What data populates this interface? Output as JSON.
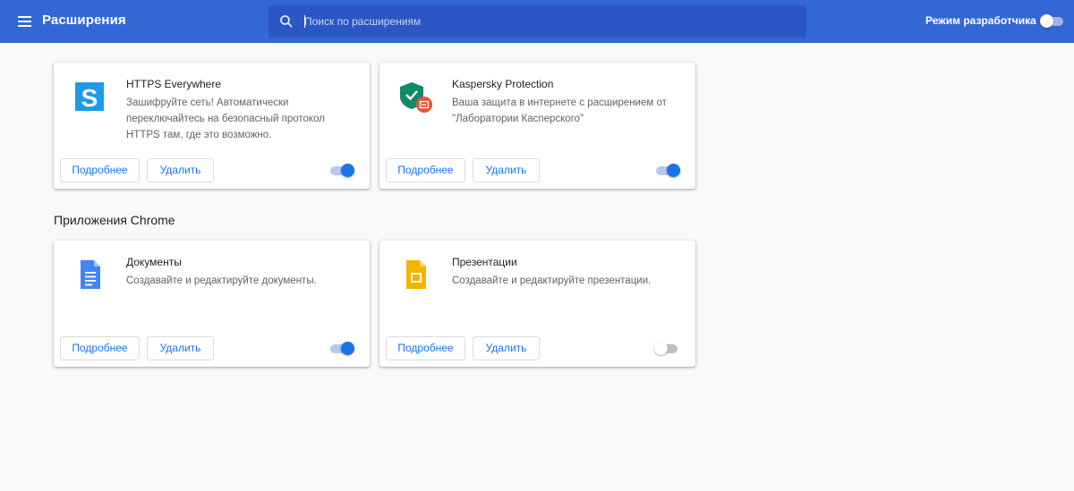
{
  "header": {
    "title": "Расширения",
    "search_placeholder": "Поиск по расширениям",
    "devmode_label": "Режим разработчика",
    "devmode_enabled": false
  },
  "extensions": [
    {
      "name": "HTTPS Everywhere",
      "description": "Зашифруйте сеть! Автоматически переключайтесь на безопасный протокол HTTPS там, где это возможно.",
      "details_label": "Подробнее",
      "remove_label": "Удалить",
      "enabled": true,
      "icon": "https-everywhere-icon"
    },
    {
      "name": "Kaspersky Protection",
      "description": "Ваша защита в интернете с расширением от \"Лаборатории Касперского\"",
      "details_label": "Подробнее",
      "remove_label": "Удалить",
      "enabled": true,
      "icon": "kaspersky-protection-icon"
    }
  ],
  "apps_section": {
    "title": "Приложения Chrome"
  },
  "apps": [
    {
      "name": "Документы",
      "description": "Создавайте и редактируйте документы.",
      "details_label": "Подробнее",
      "remove_label": "Удалить",
      "enabled": true,
      "icon": "google-docs-icon"
    },
    {
      "name": "Презентации",
      "description": "Создавайте и редактируйте презентации.",
      "details_label": "Подробнее",
      "remove_label": "Удалить",
      "enabled": false,
      "icon": "google-slides-icon"
    }
  ],
  "colors": {
    "header_bg": "#3367d6",
    "search_bg": "#2a56c6",
    "accent": "#1a73e8",
    "page_bg": "#f8f9fa"
  }
}
